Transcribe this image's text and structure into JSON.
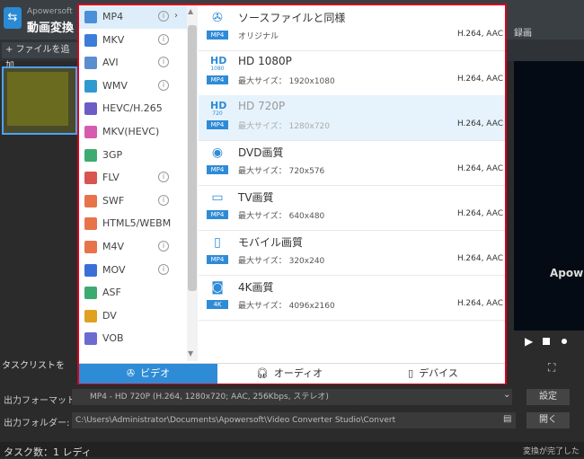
{
  "app": {
    "brand": "Apowersoft",
    "title": "動画変換",
    "add_file_label": "+ ファイルを追加",
    "record_label": "録画",
    "preview_text": "Apow",
    "task_clear": "タスクリストを",
    "status_text": "タスク数：1  レディ",
    "after_convert": "変換が完了した"
  },
  "output": {
    "format_label": "出力フォーマット:",
    "format_value": "MP4 - HD 720P (H.264, 1280x720; AAC, 256Kbps, ステレオ)",
    "folder_label": "出力フォルダー:",
    "folder_value": "C:\\Users\\Administrator\\Documents\\Apowersoft\\Video Converter Studio\\Convert",
    "settings_button": "設定",
    "open_button": "開く"
  },
  "formats": [
    {
      "label": "MP4",
      "color": "#4a90d9",
      "icon": "mp4-icon",
      "info": "i",
      "selected": true
    },
    {
      "label": "MKV",
      "color": "#3b7dd8",
      "icon": "mkv-icon",
      "info": "i"
    },
    {
      "label": "AVI",
      "color": "#5a8ecf",
      "icon": "avi-icon",
      "info": "i"
    },
    {
      "label": "WMV",
      "color": "#2f9ad0",
      "icon": "wmv-icon",
      "info": "i"
    },
    {
      "label": "HEVC/H.265",
      "color": "#6b5cc8",
      "icon": "hevc-icon"
    },
    {
      "label": "MKV(HEVC)",
      "color": "#d65cb0",
      "icon": "mkv-hevc-icon"
    },
    {
      "label": "3GP",
      "color": "#3dab6f",
      "icon": "3gp-icon"
    },
    {
      "label": "FLV",
      "color": "#d9534f",
      "icon": "flv-icon",
      "info": "i"
    },
    {
      "label": "SWF",
      "color": "#e8734a",
      "icon": "swf-icon",
      "info": "i"
    },
    {
      "label": "HTML5/WEBM",
      "color": "#e8734a",
      "icon": "html5-icon"
    },
    {
      "label": "M4V",
      "color": "#e8734a",
      "icon": "m4v-icon",
      "info": "i"
    },
    {
      "label": "MOV",
      "color": "#3b6fd8",
      "icon": "mov-icon",
      "info": "i"
    },
    {
      "label": "ASF",
      "color": "#3dab6f",
      "icon": "asf-icon"
    },
    {
      "label": "DV",
      "color": "#e0a020",
      "icon": "dv-icon"
    },
    {
      "label": "VOB",
      "color": "#6b6bd0",
      "icon": "vob-icon"
    }
  ],
  "resolutions": [
    {
      "title": "ソースファイルと同様",
      "sub": "オリジナル",
      "codec": "H.264, AAC",
      "badge": "MP4",
      "icon": "film-reel-icon"
    },
    {
      "title": "HD 1080P",
      "sub": "最大サイズ： 1920x1080",
      "codec": "H.264, AAC",
      "badge": "MP4",
      "icon": "hd-1080-icon",
      "glyph_text": "HD",
      "glyph_sub": "1080"
    },
    {
      "title": "HD 720P",
      "sub": "最大サイズ： 1280x720",
      "codec": "H.264, AAC",
      "badge": "MP4",
      "icon": "hd-720-icon",
      "glyph_text": "HD",
      "glyph_sub": "720",
      "selected": true
    },
    {
      "title": "DVD画質",
      "sub": "最大サイズ： 720x576",
      "codec": "H.264, AAC",
      "badge": "MP4",
      "icon": "dvd-icon"
    },
    {
      "title": "TV画質",
      "sub": "最大サイズ： 640x480",
      "codec": "H.264, AAC",
      "badge": "MP4",
      "icon": "tv-icon"
    },
    {
      "title": "モバイル画質",
      "sub": "最大サイズ： 320x240",
      "codec": "H.264, AAC",
      "badge": "MP4",
      "icon": "mobile-icon"
    },
    {
      "title": "4K画質",
      "sub": "最大サイズ： 4096x2160",
      "codec": "H.264, AAC",
      "badge": "4K",
      "icon": "camera-4k-icon"
    }
  ],
  "tabs": {
    "video": "ビデオ",
    "audio": "オーディオ",
    "device": "デバイス"
  }
}
